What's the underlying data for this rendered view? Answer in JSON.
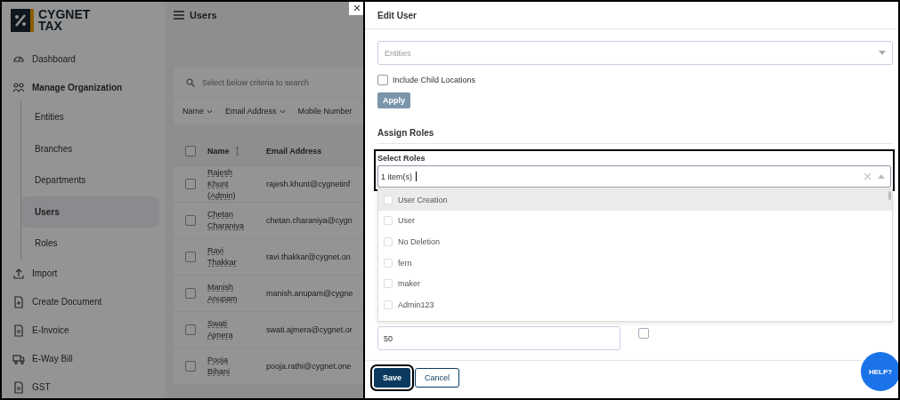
{
  "sidebar": {
    "logo": {
      "line_1": "CYGNET",
      "line_2": "TAX"
    },
    "items": [
      {
        "label": "Dashboard",
        "kind": "dashboard"
      },
      {
        "label": "Manage Organization",
        "kind": "org",
        "children": [
          {
            "label": "Entities",
            "selected": false
          },
          {
            "label": "Branches",
            "selected": false
          },
          {
            "label": "Departments",
            "selected": false
          },
          {
            "label": "Users",
            "selected": true
          },
          {
            "label": "Roles",
            "selected": false
          }
        ]
      },
      {
        "label": "Import",
        "kind": "import"
      },
      {
        "label": "Create Document",
        "kind": "document"
      },
      {
        "label": "E-Invoice",
        "kind": "invoice"
      },
      {
        "label": "E-Way Bill",
        "kind": "truck"
      },
      {
        "label": "GST",
        "kind": "gst"
      }
    ]
  },
  "main": {
    "title": "Users",
    "search": {
      "placeholder": "Select below criteria to search"
    },
    "filters": [
      "Name",
      "Email Address",
      "Mobile Number"
    ],
    "table": {
      "columns": [
        "Name",
        "Email Address"
      ],
      "header_checked": false,
      "rows": [
        {
          "name": "Rajesh Khunt (Admin)",
          "email": "rajesh.khunt@cygnetinf",
          "checked": false
        },
        {
          "name": "Chetan Charaniya",
          "email": "chetan.charaniya@cygn",
          "checked": false
        },
        {
          "name": "Ravi Thakkar",
          "email": "ravi.thakkar@cygnet.on",
          "checked": false
        },
        {
          "name": "Manish Anupam",
          "email": "manish.anupam@cygne",
          "checked": false
        },
        {
          "name": "Swati Ajmera",
          "email": "swati.ajmera@cygnet.or",
          "checked": false
        },
        {
          "name": "Pooja Bihani",
          "email": "pooja.rathi@cygnet.one",
          "checked": false
        }
      ]
    }
  },
  "close_button": "×",
  "drawer": {
    "title": "Edit User",
    "entities": {
      "placeholder": "Entities"
    },
    "include_child": {
      "label": "Include Child Locations",
      "checked": false
    },
    "apply": {
      "label": "Apply",
      "disabled": true
    },
    "assign_roles": "Assign Roles",
    "select_roles": {
      "label": "Select Roles",
      "value": "1 item(s)",
      "options": [
        {
          "label": "User Creation",
          "checked": false,
          "highlighted": true
        },
        {
          "label": "User",
          "checked": false,
          "highlighted": false
        },
        {
          "label": "No Deletion",
          "checked": false,
          "highlighted": false
        },
        {
          "label": "fern",
          "checked": false,
          "highlighted": false
        },
        {
          "label": "maker",
          "checked": false,
          "highlighted": false
        },
        {
          "label": "Admin123",
          "checked": false,
          "highlighted": false
        }
      ]
    },
    "number_field": {
      "value": "50"
    },
    "extra_checkbox": {
      "checked": false
    },
    "buttons": [
      {
        "label": "Save",
        "kind": "primary"
      },
      {
        "label": "Cancel",
        "kind": "secondary"
      }
    ]
  },
  "help": {
    "label": "HELP?"
  }
}
